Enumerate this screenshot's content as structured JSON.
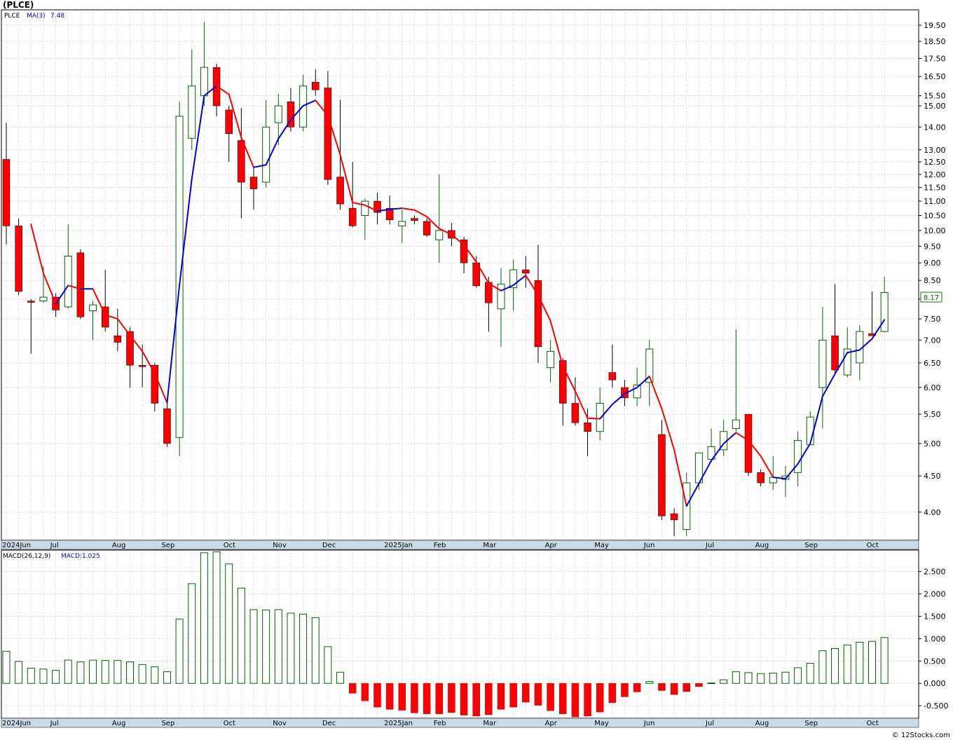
{
  "ticker_title": "(PLCE)",
  "watermark": "© 12Stocks.com",
  "price_legend": {
    "symbol": "PLCE",
    "ma_label": "MA(3)",
    "ma_value": "7.48"
  },
  "macd_legend": {
    "label": "MACD(26,12,9)",
    "value_label": "MACD:1.025"
  },
  "last_price_tag": "8.17",
  "colors": {
    "up_candle_border": "#006400",
    "down_candle": "#ff0000",
    "ma_up": "#0000dd",
    "ma_down": "#ff0000",
    "macd_pos": "#006400",
    "macd_neg": "#ff0000",
    "axis_bar": "#c8dce8",
    "grid": "#c8c8c8"
  },
  "chart_data": [
    {
      "type": "candlestick",
      "series_name": "PLCE",
      "interval": "weekly",
      "y_scale": "log",
      "ylim": [
        3.65,
        20.5
      ],
      "y_ticks": [
        4.0,
        4.5,
        5.0,
        5.5,
        6.0,
        6.5,
        7.0,
        7.5,
        8.0,
        8.5,
        9.0,
        9.5,
        10.0,
        10.5,
        11.0,
        11.5,
        12.0,
        12.5,
        13.0,
        14.0,
        15.0,
        15.5,
        16.5,
        17.5,
        18.5,
        19.5
      ],
      "x_month_labels": [
        {
          "index": 0,
          "label": "2024Jun"
        },
        {
          "index": 4,
          "label": "Jul"
        },
        {
          "index": 9,
          "label": "Aug"
        },
        {
          "index": 13,
          "label": "Sep"
        },
        {
          "index": 18,
          "label": "Oct"
        },
        {
          "index": 22,
          "label": "Nov"
        },
        {
          "index": 26,
          "label": "Dec"
        },
        {
          "index": 31,
          "label": "2025Jan"
        },
        {
          "index": 35,
          "label": "Feb"
        },
        {
          "index": 39,
          "label": "Mar"
        },
        {
          "index": 44,
          "label": "Apr"
        },
        {
          "index": 48,
          "label": "May"
        },
        {
          "index": 52,
          "label": "Jun"
        },
        {
          "index": 57,
          "label": "Jul"
        },
        {
          "index": 61,
          "label": "Aug"
        },
        {
          "index": 65,
          "label": "Sep"
        },
        {
          "index": 70,
          "label": "Oct"
        }
      ],
      "ohlc": [
        [
          12.6,
          14.2,
          9.55,
          10.15
        ],
        [
          10.15,
          10.4,
          8.1,
          8.2
        ],
        [
          7.95,
          8.0,
          6.7,
          7.92
        ],
        [
          7.95,
          8.9,
          7.9,
          8.05
        ],
        [
          8.05,
          8.15,
          7.55,
          7.72
        ],
        [
          7.8,
          10.2,
          7.75,
          9.2
        ],
        [
          9.3,
          9.4,
          7.5,
          7.55
        ],
        [
          7.7,
          7.95,
          7.0,
          7.85
        ],
        [
          7.8,
          8.8,
          7.2,
          7.3
        ],
        [
          7.1,
          7.75,
          6.75,
          6.95
        ],
        [
          7.2,
          7.3,
          6.0,
          6.45
        ],
        [
          6.45,
          6.9,
          6.0,
          6.42
        ],
        [
          6.45,
          6.5,
          5.55,
          5.7
        ],
        [
          5.6,
          5.7,
          4.95,
          5.0
        ],
        [
          5.1,
          15.2,
          4.8,
          14.5
        ],
        [
          13.5,
          18.0,
          13.0,
          16.0
        ],
        [
          15.5,
          19.7,
          15.0,
          17.0
        ],
        [
          17.0,
          17.2,
          14.5,
          15.0
        ],
        [
          14.8,
          15.0,
          12.5,
          13.7
        ],
        [
          13.4,
          14.9,
          10.4,
          11.7
        ],
        [
          11.9,
          12.3,
          10.7,
          11.45
        ],
        [
          11.7,
          15.3,
          11.5,
          14.0
        ],
        [
          14.2,
          15.6,
          13.2,
          15.0
        ],
        [
          15.2,
          15.9,
          13.8,
          14.0
        ],
        [
          14.0,
          16.6,
          13.8,
          16.0
        ],
        [
          16.2,
          16.9,
          15.5,
          15.8
        ],
        [
          15.9,
          16.8,
          11.6,
          11.8
        ],
        [
          11.9,
          15.3,
          10.7,
          10.9
        ],
        [
          10.75,
          12.5,
          10.1,
          10.15
        ],
        [
          10.5,
          11.1,
          9.7,
          11.0
        ],
        [
          11.0,
          11.3,
          10.2,
          10.6
        ],
        [
          10.75,
          11.2,
          10.2,
          10.35
        ],
        [
          10.15,
          10.7,
          9.6,
          10.3
        ],
        [
          10.4,
          10.5,
          10.2,
          10.33
        ],
        [
          10.3,
          10.4,
          9.8,
          9.85
        ],
        [
          9.7,
          12.0,
          9.0,
          10.0
        ],
        [
          10.0,
          10.25,
          9.5,
          9.75
        ],
        [
          9.7,
          9.8,
          8.7,
          9.0
        ],
        [
          9.0,
          9.2,
          8.3,
          8.35
        ],
        [
          8.45,
          8.6,
          7.2,
          7.9
        ],
        [
          7.75,
          8.85,
          6.85,
          8.4
        ],
        [
          8.3,
          9.1,
          7.7,
          8.8
        ],
        [
          8.8,
          9.2,
          8.3,
          8.7
        ],
        [
          8.5,
          9.55,
          6.5,
          6.85
        ],
        [
          6.4,
          7.0,
          6.1,
          6.75
        ],
        [
          6.55,
          6.6,
          5.3,
          5.7
        ],
        [
          5.7,
          6.2,
          5.3,
          5.35
        ],
        [
          5.35,
          5.6,
          4.8,
          5.2
        ],
        [
          5.2,
          6.0,
          5.05,
          5.7
        ],
        [
          6.3,
          6.9,
          6.0,
          6.15
        ],
        [
          6.0,
          6.15,
          5.65,
          5.8
        ],
        [
          5.8,
          6.4,
          5.65,
          6.05
        ],
        [
          6.1,
          7.0,
          5.65,
          6.8
        ],
        [
          5.15,
          5.4,
          3.9,
          3.95
        ],
        [
          3.98,
          4.05,
          3.7,
          3.9
        ],
        [
          3.78,
          4.55,
          3.7,
          4.4
        ],
        [
          4.4,
          4.7,
          4.3,
          4.85
        ],
        [
          4.75,
          5.25,
          4.7,
          4.95
        ],
        [
          4.9,
          5.4,
          4.8,
          5.2
        ],
        [
          5.25,
          7.25,
          5.2,
          5.4
        ],
        [
          5.5,
          5.5,
          4.5,
          4.55
        ],
        [
          4.55,
          4.6,
          4.35,
          4.4
        ],
        [
          4.4,
          4.8,
          4.3,
          4.48
        ],
        [
          4.45,
          4.65,
          4.2,
          4.5
        ],
        [
          4.55,
          5.2,
          4.35,
          5.05
        ],
        [
          4.98,
          5.55,
          5.0,
          5.45
        ],
        [
          6.0,
          7.8,
          5.25,
          7.0
        ],
        [
          7.1,
          8.4,
          6.3,
          6.35
        ],
        [
          6.25,
          7.3,
          6.2,
          6.8
        ],
        [
          6.5,
          7.35,
          6.15,
          7.2
        ],
        [
          7.15,
          8.2,
          7.1,
          7.1
        ],
        [
          7.2,
          8.6,
          7.18,
          8.17
        ]
      ],
      "ma3": [
        null,
        null,
        10.2,
        8.7,
        7.88,
        8.36,
        8.27,
        8.27,
        7.6,
        7.5,
        7.11,
        6.75,
        6.28,
        5.71,
        8.37,
        11.83,
        15.5,
        16.0,
        15.57,
        13.53,
        12.28,
        12.38,
        13.48,
        14.33,
        15.0,
        15.27,
        14.53,
        12.79,
        10.95,
        10.86,
        10.65,
        10.71,
        10.75,
        10.69,
        10.46,
        10.06,
        9.87,
        9.54,
        9.03,
        8.42,
        8.22,
        8.37,
        8.64,
        8.1,
        7.45,
        6.43,
        5.93,
        5.43,
        5.42,
        5.68,
        5.88,
        6.0,
        6.22,
        5.6,
        4.9,
        4.08,
        4.39,
        4.73,
        5.0,
        5.18,
        5.05,
        4.8,
        4.48,
        4.46,
        4.68,
        5.0,
        5.83,
        6.27,
        6.72,
        6.78,
        7.03,
        7.48
      ],
      "ma_colors": [
        "",
        "",
        "down",
        "down",
        "down",
        "up",
        "down",
        "up",
        "down",
        "down",
        "down",
        "down",
        "down",
        "down",
        "up",
        "up",
        "up",
        "up",
        "down",
        "down",
        "down",
        "up",
        "up",
        "up",
        "up",
        "up",
        "down",
        "down",
        "down",
        "down",
        "down",
        "up",
        "up",
        "down",
        "down",
        "down",
        "down",
        "down",
        "down",
        "down",
        "down",
        "up",
        "up",
        "down",
        "down",
        "down",
        "down",
        "down",
        "down",
        "up",
        "up",
        "up",
        "up",
        "down",
        "down",
        "down",
        "up",
        "up",
        "up",
        "up",
        "down",
        "down",
        "down",
        "up",
        "up",
        "up",
        "up",
        "up",
        "up",
        "up",
        "up",
        "up"
      ]
    },
    {
      "type": "bar",
      "series_name": "MACD(26,12,9)",
      "ylim": [
        -0.78,
        2.98
      ],
      "y_ticks": [
        -0.5,
        0.0,
        0.5,
        1.0,
        1.5,
        2.0,
        2.5
      ],
      "values": [
        0.72,
        0.49,
        0.34,
        0.32,
        0.29,
        0.52,
        0.48,
        0.52,
        0.51,
        0.51,
        0.48,
        0.42,
        0.37,
        0.26,
        1.44,
        2.23,
        2.92,
        2.94,
        2.67,
        2.13,
        1.65,
        1.64,
        1.65,
        1.57,
        1.55,
        1.47,
        0.82,
        0.25,
        -0.22,
        -0.39,
        -0.53,
        -0.58,
        -0.6,
        -0.66,
        -0.68,
        -0.68,
        -0.65,
        -0.71,
        -0.73,
        -0.7,
        -0.58,
        -0.53,
        -0.42,
        -0.49,
        -0.61,
        -0.68,
        -0.75,
        -0.73,
        -0.64,
        -0.43,
        -0.3,
        -0.19,
        0.04,
        -0.16,
        -0.25,
        -0.18,
        -0.07,
        0.01,
        0.08,
        0.26,
        0.24,
        0.22,
        0.23,
        0.25,
        0.35,
        0.45,
        0.73,
        0.78,
        0.86,
        0.92,
        0.94,
        1.025
      ]
    }
  ]
}
